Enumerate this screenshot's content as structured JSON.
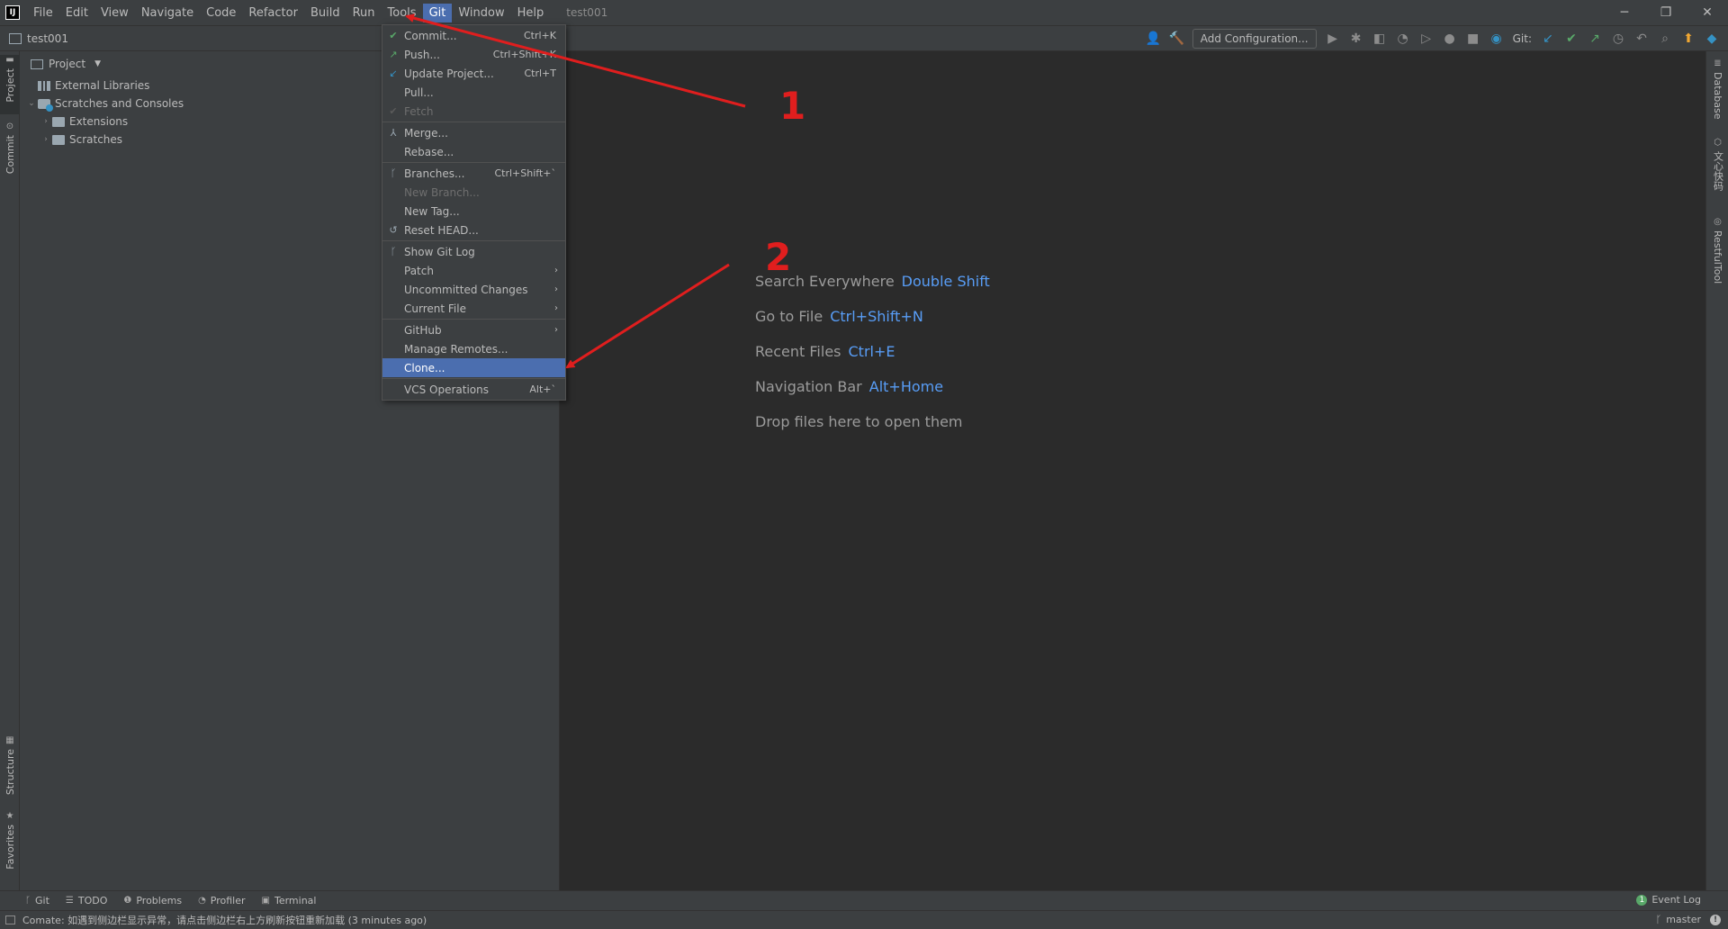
{
  "menubar": {
    "items": [
      "File",
      "Edit",
      "View",
      "Navigate",
      "Code",
      "Refactor",
      "Build",
      "Run",
      "Tools",
      "Git",
      "Window",
      "Help"
    ],
    "active_index": 9,
    "window_title": "test001",
    "logo_text": "IJ",
    "window_controls": [
      "─",
      "❐",
      "✕"
    ]
  },
  "navbar": {
    "breadcrumb": "test001",
    "add_config_label": "Add Configuration...",
    "git_label": "Git:"
  },
  "left_stripe": {
    "tabs": [
      "Project",
      "Commit",
      "Structure",
      "Favorites"
    ]
  },
  "project_panel": {
    "title": "Project",
    "tree": [
      {
        "label": "External Libraries",
        "level": 0,
        "expander": "",
        "icon": "library-icon"
      },
      {
        "label": "Scratches and Consoles",
        "level": 0,
        "expander": "⌄",
        "icon": "scratches-icon"
      },
      {
        "label": "Extensions",
        "level": 1,
        "expander": "›",
        "icon": "folder-icon"
      },
      {
        "label": "Scratches",
        "level": 1,
        "expander": "›",
        "icon": "folder-icon"
      }
    ]
  },
  "git_menu": {
    "items": [
      {
        "label": "Commit...",
        "shortcut": "Ctrl+K",
        "icon": "check-icon",
        "icon_class": "green"
      },
      {
        "label": "Push...",
        "shortcut": "Ctrl+Shift+K",
        "icon": "push-arrow-icon",
        "icon_class": "green"
      },
      {
        "label": "Update Project...",
        "shortcut": "Ctrl+T",
        "icon": "update-arrow-icon",
        "icon_class": "blue"
      },
      {
        "label": "Pull...",
        "shortcut": ""
      },
      {
        "label": "Fetch",
        "shortcut": "",
        "disabled": true,
        "icon": "fetch-icon",
        "icon_class": "dim"
      },
      {
        "separator": true
      },
      {
        "label": "Merge...",
        "shortcut": "",
        "icon": "merge-icon",
        "icon_class": "gray"
      },
      {
        "label": "Rebase...",
        "shortcut": ""
      },
      {
        "separator": true
      },
      {
        "label": "Branches...",
        "shortcut": "Ctrl+Shift+`",
        "icon": "branch-icon",
        "icon_class": "gray"
      },
      {
        "label": "New Branch...",
        "shortcut": "",
        "disabled": true
      },
      {
        "label": "New Tag...",
        "shortcut": ""
      },
      {
        "label": "Reset HEAD...",
        "shortcut": "",
        "icon": "reset-icon",
        "icon_class": "gray"
      },
      {
        "separator": true
      },
      {
        "label": "Show Git Log",
        "shortcut": "",
        "icon": "git-log-icon",
        "icon_class": "gray"
      },
      {
        "label": "Patch",
        "shortcut": "",
        "submenu": true
      },
      {
        "label": "Uncommitted Changes",
        "shortcut": "",
        "submenu": true
      },
      {
        "label": "Current File",
        "shortcut": "",
        "submenu": true
      },
      {
        "separator": true
      },
      {
        "label": "GitHub",
        "shortcut": "",
        "submenu": true
      },
      {
        "label": "Manage Remotes...",
        "shortcut": ""
      },
      {
        "label": "Clone...",
        "shortcut": "",
        "selected": true
      },
      {
        "separator": true
      },
      {
        "label": "VCS Operations",
        "shortcut": "Alt+`"
      }
    ]
  },
  "editor_hints": [
    {
      "text": "Search Everywhere",
      "key": "Double Shift"
    },
    {
      "text": "Go to File",
      "key": "Ctrl+Shift+N"
    },
    {
      "text": "Recent Files",
      "key": "Ctrl+E"
    },
    {
      "text": "Navigation Bar",
      "key": "Alt+Home"
    },
    {
      "text": "Drop files here to open them",
      "key": ""
    }
  ],
  "right_stripe": {
    "tabs": [
      "Database",
      "文心快码",
      "RestfulTool"
    ]
  },
  "bottom_tools": {
    "items": [
      {
        "label": "Git",
        "icon": "branch-icon"
      },
      {
        "label": "TODO",
        "icon": "list-icon"
      },
      {
        "label": "Problems",
        "icon": "info-icon"
      },
      {
        "label": "Profiler",
        "icon": "profiler-icon"
      },
      {
        "label": "Terminal",
        "icon": "terminal-icon"
      }
    ],
    "event_log_label": "Event Log",
    "event_log_count": "1"
  },
  "statusbar": {
    "message": "Comate: 如遇到侧边栏显示异常，请点击侧边栏右上方刷新按钮重新加载 (3 minutes ago)",
    "branch": "master"
  },
  "annotations": {
    "labels": [
      "1",
      "2"
    ],
    "color": "#e01e1e"
  },
  "colors": {
    "accent": "#4b6eaf",
    "link_key": "#589df6",
    "green": "#59a869"
  }
}
